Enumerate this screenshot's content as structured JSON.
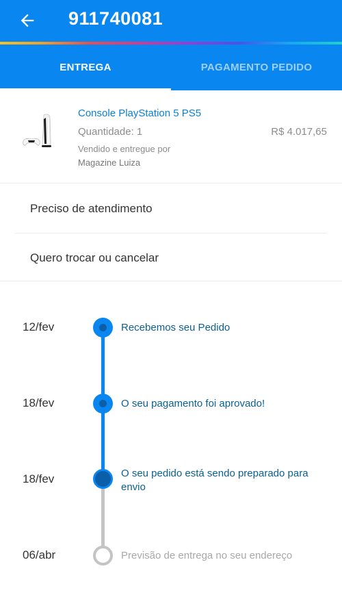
{
  "header": {
    "order_number": "911740081",
    "back_icon": "arrow-left-icon"
  },
  "tabs": [
    {
      "label": "ENTREGA",
      "active": true
    },
    {
      "label": "PAGAMENTO PEDIDO",
      "active": false
    }
  ],
  "product": {
    "name": "Console PlayStation 5 PS5",
    "quantity": "Quantidade: 1",
    "price": "R$ 4.017,65",
    "seller_label": "Vendido e entregue por",
    "seller_name": "Magazine Luiza",
    "image_icon": "ps5-console-icon"
  },
  "actions": [
    {
      "label": "Preciso de atendimento"
    },
    {
      "label": "Quero trocar ou cancelar"
    }
  ],
  "timeline": [
    {
      "date": "12/fev",
      "text": "Recebemos seu Pedido",
      "status": "done"
    },
    {
      "date": "18/fev",
      "text": "O seu pagamento foi aprovado!",
      "status": "done"
    },
    {
      "date": "18/fev",
      "text": "O seu pedido está sendo preparado para envio",
      "status": "current"
    },
    {
      "date": "06/abr",
      "text": "Previsão de entrega no seu endereço",
      "status": "pending"
    }
  ],
  "colors": {
    "brand": "#0a86f1",
    "progress_dark": "#0b5fa8",
    "pending": "#c4c4c4",
    "product_link": "#0a7fd6"
  }
}
